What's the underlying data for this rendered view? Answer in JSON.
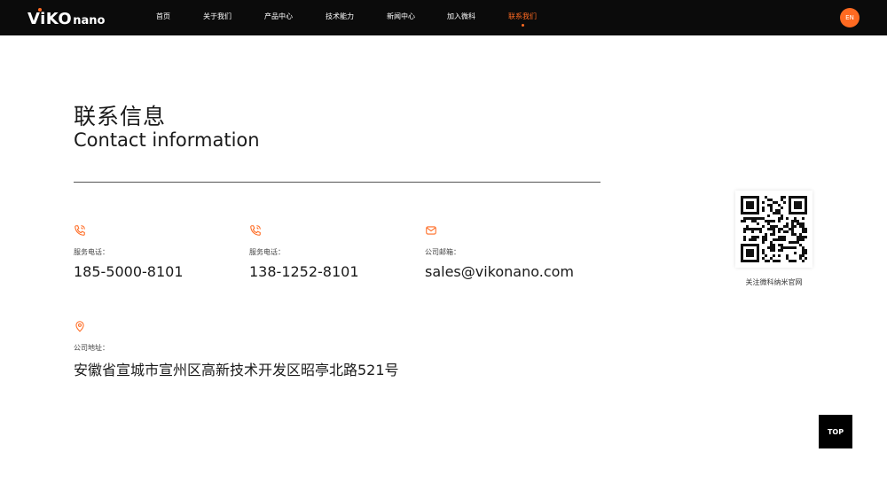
{
  "header": {
    "logo_main": "ViKO",
    "logo_sub": "nano",
    "nav": [
      {
        "label": "首页"
      },
      {
        "label": "关于我们"
      },
      {
        "label": "产品中心"
      },
      {
        "label": "技术能力"
      },
      {
        "label": "新闻中心"
      },
      {
        "label": "加入微科"
      },
      {
        "label": "联系我们"
      }
    ],
    "active_nav": "联系我们",
    "lang_label": "EN"
  },
  "contact": {
    "title_cn": "联系信息",
    "title_en": "Contact information",
    "phone1": {
      "icon": "phone-icon",
      "label": "服务电话：",
      "value": "185-5000-8101"
    },
    "phone2": {
      "icon": "phone-icon",
      "label": "服务电话：",
      "value": "138-1252-8101"
    },
    "email": {
      "icon": "mail-icon",
      "label": "公司邮箱：",
      "value": "sales@vikonano.com"
    },
    "address": {
      "icon": "location-pin-icon",
      "label": "公司地址：",
      "value": "安徽省宣城市宣州区高新技术开发区昭亭北路521号"
    }
  },
  "qr": {
    "caption": "关注微科纳米官网"
  },
  "top_button": {
    "label": "TOP"
  },
  "colors": {
    "accent": "#ff6a21",
    "header_bg": "#0b0b0b",
    "text": "#1a1a1a"
  }
}
